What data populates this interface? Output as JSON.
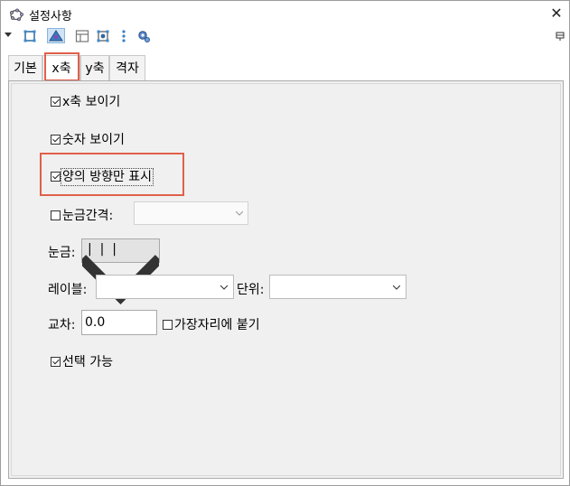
{
  "window": {
    "title": "설정사항",
    "close_glyph": "✕"
  },
  "toolbar": {
    "icons": [
      "dropdown-arrow-icon",
      "square-select-icon",
      "graphics-view-icon",
      "layout-panel-icon",
      "grid-select-icon",
      "dots-menu-icon",
      "gear-icon"
    ],
    "pin_icon": "pin-icon"
  },
  "tabs": [
    {
      "label": "기본",
      "active": false
    },
    {
      "label": "x축",
      "active": true
    },
    {
      "label": "y축",
      "active": false
    },
    {
      "label": "격자",
      "active": false
    }
  ],
  "xaxis": {
    "show_axis": {
      "label": "x축 보이기",
      "checked": true
    },
    "show_numbers": {
      "label": "숫자 보이기",
      "checked": true
    },
    "positive_only": {
      "label": "양의 방향만 표시",
      "checked": true
    },
    "tick_interval": {
      "label": "눈금간격:",
      "checked": false,
      "value": ""
    },
    "ticks": {
      "label": "눈금:",
      "value": "|  |  |"
    },
    "label_field": {
      "label": "레이블:",
      "value": ""
    },
    "unit_field": {
      "label": "단위:",
      "value": ""
    },
    "cross": {
      "label": "교차:",
      "value": "0.0"
    },
    "stick_to_edge": {
      "label": "가장자리에 붙기",
      "checked": false
    },
    "selectable": {
      "label": "선택 가능",
      "checked": true
    }
  },
  "colors": {
    "highlight": "#e0604a",
    "active_tool": "#cfe3f5"
  }
}
